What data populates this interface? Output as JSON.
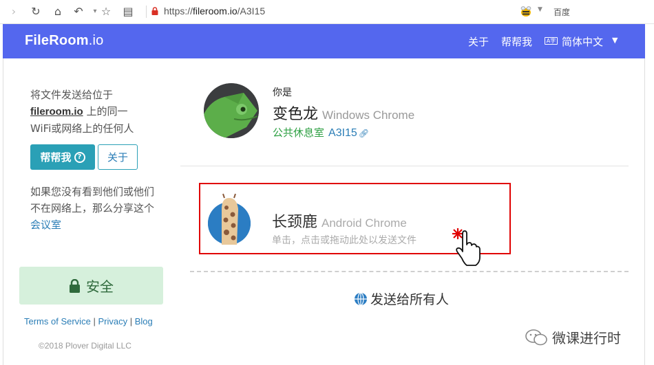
{
  "browser": {
    "url_scheme": "https://",
    "url_host": "fileroom.io",
    "url_path": "/A3I15",
    "search_engine": "百度",
    "icons": [
      "forward-icon",
      "reload-icon",
      "home-icon",
      "undo-icon",
      "star-icon",
      "reader-icon",
      "lock-icon",
      "bee-icon"
    ]
  },
  "header": {
    "brand_main": "FileRoom",
    "brand_suffix": ".io",
    "nav_about": "关于",
    "nav_help": "帮帮我",
    "language": "简体中文",
    "color": "#5467ee"
  },
  "sidebar": {
    "intro_line1": "将文件发送给位于",
    "intro_link": "fileroom.io",
    "intro_line2": "上的同一",
    "intro_line3": "WiFi或网络上的任何人",
    "help_button": "帮帮我",
    "about_button": "关于",
    "share_text": "如果您没有看到他们或他们不在网络上，那么分享这个",
    "share_link": "会议室",
    "secure_label": "安全",
    "footer_terms": "Terms of Service",
    "footer_privacy": "Privacy",
    "footer_blog": "Blog",
    "footer_sep": "|",
    "copyright": "©2018 Plover Digital LLC"
  },
  "me": {
    "you_are": "你是",
    "name": "变色龙",
    "device": "Windows Chrome",
    "room_label": "公共休息室",
    "room_code": "A3I15"
  },
  "peer": {
    "name": "长颈鹿",
    "device": "Android Chrome",
    "hint": "单击，点击或拖动此处以发送文件"
  },
  "send_all": "发送给所有人",
  "watermark": "微课进行时",
  "colors": {
    "accent": "#5467ee",
    "teal": "#2aa0b6",
    "link": "#2a7db6",
    "green": "#2ea043",
    "highlight": "#e00000"
  }
}
